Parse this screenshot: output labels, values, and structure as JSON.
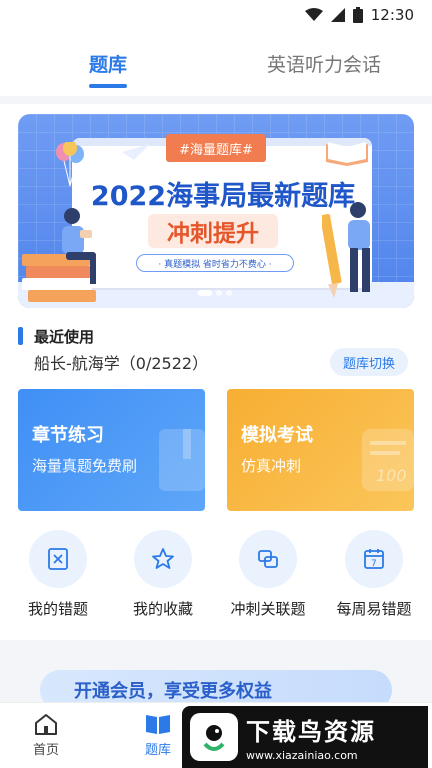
{
  "status_bar": {
    "time": "12:30"
  },
  "top_tabs": [
    {
      "label": "题库",
      "active": true
    },
    {
      "label": "英语听力会话",
      "active": false
    }
  ],
  "banner": {
    "tag": "#海量题库#",
    "title": "2022海事局最新题库",
    "subtitle": "冲刺提升",
    "small_text": "· 真题模拟  省时省力不费心 ·",
    "page_count": 3,
    "active_index": 0
  },
  "recent": {
    "title": "最近使用",
    "course": "船长-航海学（0/2522）",
    "switch_label": "题库切换"
  },
  "cards": [
    {
      "title": "章节练习",
      "subtitle": "海量真题免费刷"
    },
    {
      "title": "模拟考试",
      "subtitle": "仿真冲刺"
    }
  ],
  "tools": [
    {
      "label": "我的错题",
      "icon": "wrong-questions-icon"
    },
    {
      "label": "我的收藏",
      "icon": "star-icon"
    },
    {
      "label": "冲刺关联题",
      "icon": "linked-icon"
    },
    {
      "label": "每周易错题",
      "icon": "calendar-icon"
    }
  ],
  "promo": {
    "text": "开通会员，享受更多权益"
  },
  "bottom_nav": [
    {
      "label": "首页",
      "icon": "home-icon",
      "active": false
    },
    {
      "label": "题库",
      "icon": "book-icon",
      "active": true
    }
  ],
  "watermark": {
    "title": "下载鸟资源",
    "url": "www.xiazainiao.com"
  },
  "colors": {
    "accent": "#2b7ae8",
    "card_blue": "#4a96f6",
    "card_orange": "#f9b843"
  }
}
